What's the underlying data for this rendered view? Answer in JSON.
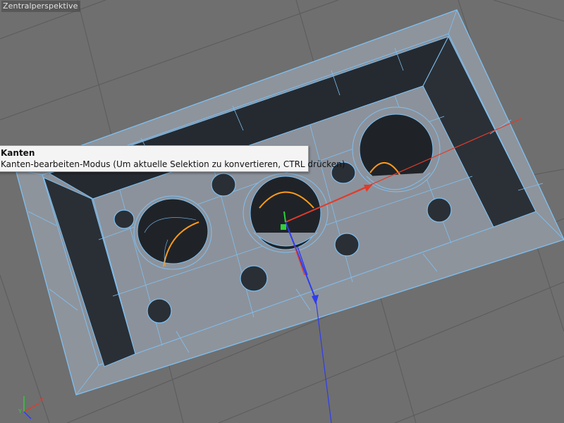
{
  "viewport": {
    "title": "Zentralperspektive",
    "background": "#6f6f6f",
    "grid_color": "#5d5d5d",
    "mesh_fill": "#8c929b",
    "mesh_wire": "#7bbdf0",
    "hole_inner": "#24282d",
    "selected_edge_color": "#ff9a1a"
  },
  "tooltip": {
    "title": "Kanten",
    "description": "Kanten-bearbeiten-Modus (Um aktuelle Selektion zu konvertieren, CTRL drücken)"
  },
  "axes": {
    "x_color": "#e23a2a",
    "y_color": "#2fcf3a",
    "z_color": "#2f3cf0",
    "gizmo_labels": {
      "x": "X",
      "y": "Y"
    }
  },
  "icons": {
    "move_gizmo": "move-axis-gizmo-icon",
    "world_axis": "world-axis-icon"
  }
}
